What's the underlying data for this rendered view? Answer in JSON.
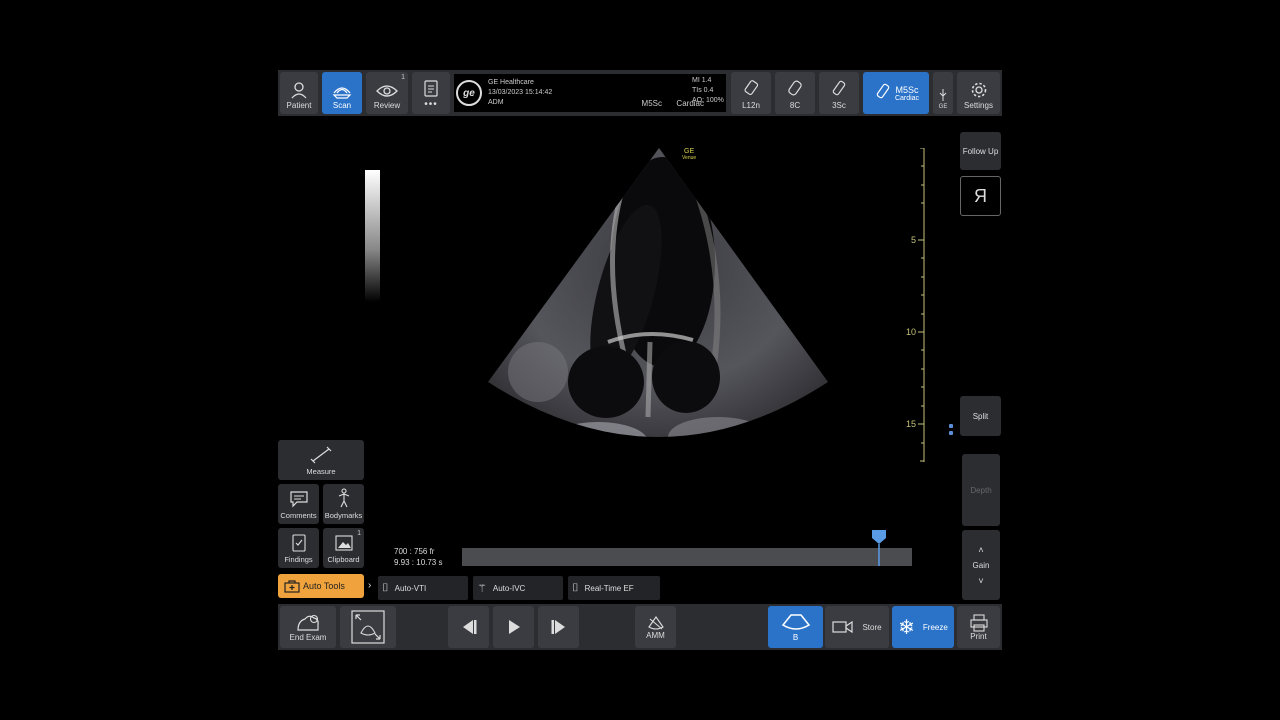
{
  "topbar": {
    "patient": "Patient",
    "scan": "Scan",
    "review": "Review",
    "review_badge": "1",
    "more": "•••",
    "org": "GE Healthcare",
    "datetime": "13/03/2023 15:14:42",
    "user": "ADM",
    "probe_mode": "M5Sc",
    "preset": "Cardiac",
    "mi": "MI 1.4",
    "tis": "TIs 0.4",
    "ao": "AO: 100%",
    "probe1": "L12n",
    "probe2": "8C",
    "probe3": "3Sc",
    "active_probe": "M5Sc",
    "active_preset": "Cardiac",
    "ge_small": "GE",
    "settings": "Settings"
  },
  "image": {
    "brand": "GE",
    "brand_sub": "Venue",
    "depth_labels": [
      "5",
      "10",
      "15"
    ]
  },
  "right_panel": {
    "follow_up": "Follow Up",
    "invert": "R",
    "split": "Split",
    "depth": "Depth",
    "gain": "Gain"
  },
  "left_tools": {
    "measure": "Measure",
    "comments": "Comments",
    "bodymarks": "Bodymarks",
    "findings": "Findings",
    "clipboard": "Clipboard",
    "clipboard_badge": "1"
  },
  "cine": {
    "frames": "700 : 756 fr",
    "time": "9.93 : 10.73 s",
    "position_fraction": 0.926
  },
  "auto_tools": {
    "label": "Auto Tools",
    "items": [
      "Auto-VTI",
      "Auto-IVC",
      "Real-Time EF"
    ]
  },
  "bottombar": {
    "end_exam": "End Exam",
    "amm": "AMM",
    "mode_b": "B",
    "store": "Store",
    "freeze": "Freeze",
    "print": "Print"
  }
}
